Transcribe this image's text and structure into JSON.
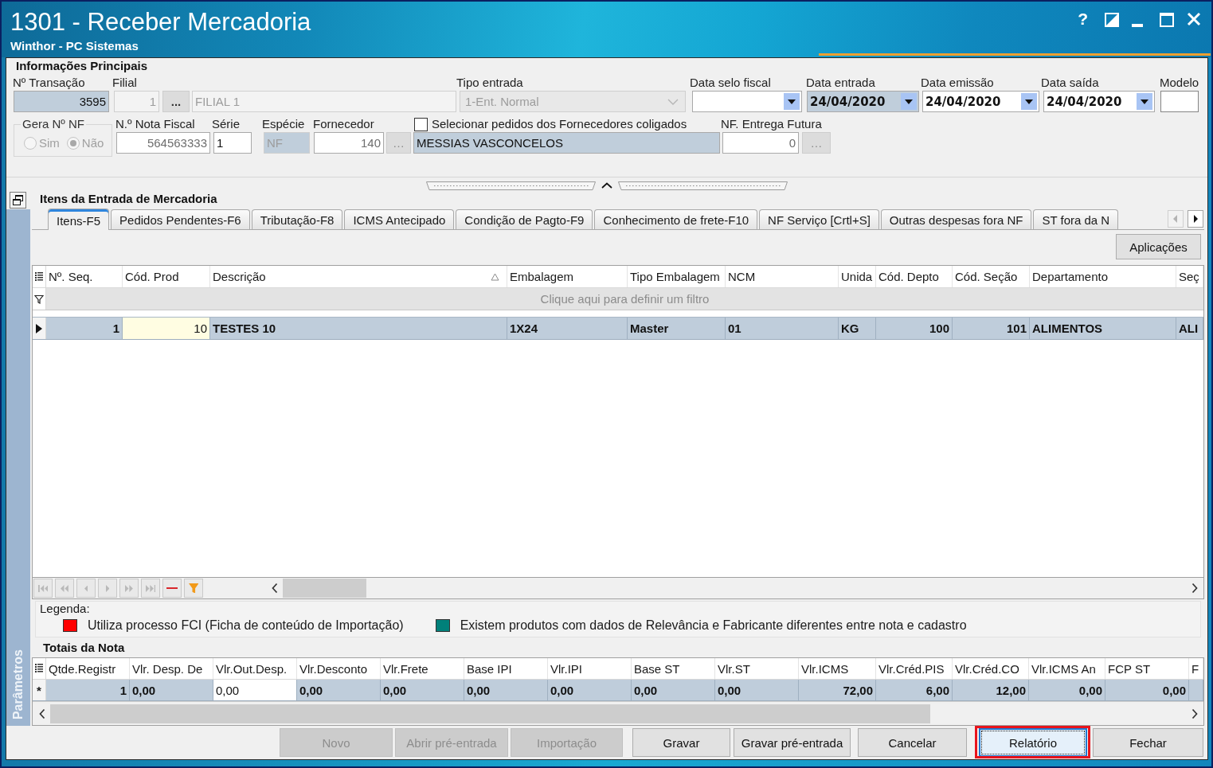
{
  "window": {
    "title": "1301 - Receber Mercadoria",
    "subtitle": "Winthor - PC Sistemas",
    "help_button": "?"
  },
  "main_info": {
    "title": "Informações Principais",
    "transacao": {
      "label": "Nº Transação",
      "value": "3595",
      "readonly": true
    },
    "filial": {
      "label": "Filial",
      "code": "1",
      "button": "...",
      "name": "FILIAL 1",
      "disabled": true
    },
    "tipo_entrada": {
      "label": "Tipo entrada",
      "value": "1-Ent. Normal",
      "disabled": true
    },
    "dates": [
      {
        "label": "Data selo fiscal",
        "readonly": false
      },
      {
        "label": "Data entrada",
        "value": "24/04/2020",
        "readonly": true
      },
      {
        "label": "Data emissão",
        "value": "24/04/2020",
        "readonly": false
      },
      {
        "label": "Data saída",
        "value": "24/04/2020",
        "readonly": false
      }
    ],
    "modelo": {
      "label": "Modelo"
    },
    "gera_nf": {
      "label": "Gera Nº NF",
      "disabled": true,
      "options": [
        {
          "label": "Sim",
          "selected": false
        },
        {
          "label": "Não",
          "selected": true
        }
      ]
    },
    "nota_fiscal": {
      "label": "N.º Nota Fiscal",
      "value": "564563333"
    },
    "serie": {
      "label": "Série",
      "value": "1"
    },
    "especie": {
      "label": "Espécie",
      "value": "NF",
      "readonly": true,
      "disabled": true
    },
    "fornecedor": {
      "label": "Fornecedor",
      "code": "140",
      "button": "…",
      "name": "MESSIAS VASCONCELOS",
      "readonly": true
    },
    "coligados": {
      "label": "Selecionar pedidos dos Fornecedores coligados",
      "checked": false
    },
    "entrega_futura": {
      "label": "NF. Entrega Futura",
      "value": "0",
      "button": "…"
    }
  },
  "sidebar": {
    "label": "Parâmetros"
  },
  "items": {
    "title": "Itens da Entrada de Mercadoria",
    "tabs": [
      {
        "label": "Itens-F5",
        "selected": true
      },
      {
        "label": "Pedidos Pendentes-F6",
        "selected": false
      },
      {
        "label": "Tributação-F8",
        "selected": false
      },
      {
        "label": "ICMS Antecipado",
        "selected": false
      },
      {
        "label": "Condição de Pagto-F9",
        "selected": false
      },
      {
        "label": "Conhecimento de frete-F10",
        "selected": false
      },
      {
        "label": "NF Serviço [Crtl+S]",
        "selected": false
      },
      {
        "label": "Outras despesas fora NF",
        "selected": false
      },
      {
        "label": "ST fora da N",
        "selected": false
      }
    ],
    "apps_button": "Aplicações",
    "grid": {
      "columns": [
        {
          "label": "Nº. Seq.",
          "right_aligned": true,
          "sorted": false
        },
        {
          "label": "Cód. Prod",
          "right_aligned": true,
          "sorted": false
        },
        {
          "label": "Descrição",
          "right_aligned": false,
          "sorted": true
        },
        {
          "label": "Embalagem",
          "right_aligned": false,
          "sorted": false
        },
        {
          "label": "Tipo Embalagem",
          "right_aligned": false,
          "sorted": false
        },
        {
          "label": "NCM",
          "right_aligned": false,
          "sorted": false
        },
        {
          "label": "Unida",
          "right_aligned": false,
          "sorted": false
        },
        {
          "label": "Cód. Depto",
          "right_aligned": true,
          "sorted": false
        },
        {
          "label": "Cód. Seção",
          "right_aligned": true,
          "sorted": false
        },
        {
          "label": "Departamento",
          "right_aligned": false,
          "sorted": false
        },
        {
          "label": "Seç",
          "right_aligned": false,
          "sorted": false
        }
      ],
      "filter_hint": "Clique aqui para definir um filtro",
      "rows": [
        {
          "selected": true,
          "cells": [
            {
              "value": "1",
              "focused": false
            },
            {
              "value": "10",
              "focused": true
            },
            {
              "value": "TESTES 10",
              "focused": false
            },
            {
              "value": "1X24",
              "focused": false
            },
            {
              "value": "Master",
              "focused": false
            },
            {
              "value": "01",
              "focused": false
            },
            {
              "value": "KG",
              "focused": false
            },
            {
              "value": "100",
              "focused": false
            },
            {
              "value": "101",
              "focused": false
            },
            {
              "value": "ALIMENTOS",
              "focused": false
            },
            {
              "value": "ALI",
              "focused": false
            }
          ]
        }
      ]
    },
    "navigator": [
      {
        "kind": "first",
        "disabled": true
      },
      {
        "kind": "prev_page",
        "disabled": true
      },
      {
        "kind": "prev",
        "disabled": true
      },
      {
        "kind": "next",
        "disabled": true
      },
      {
        "kind": "next_page",
        "disabled": true
      },
      {
        "kind": "last",
        "disabled": true
      },
      {
        "kind": "delete",
        "disabled": false
      },
      {
        "kind": "filter",
        "disabled": false
      }
    ]
  },
  "legend": {
    "title": "Legenda:",
    "items": [
      {
        "label": "Utiliza processo FCI (Ficha de conteúdo de Importação)",
        "color": "#ff0000"
      },
      {
        "label": "Existem produtos com dados de Relevância e Fabricante diferentes entre nota e cadastro",
        "color": "#00807a"
      }
    ]
  },
  "totals": {
    "title": "Totais da Nota",
    "columns": [
      {
        "label": "Qtde.Registr"
      },
      {
        "label": "Vlr. Desp. De"
      },
      {
        "label": "Vlr.Out.Desp."
      },
      {
        "label": "Vlr.Desconto"
      },
      {
        "label": "Vlr.Frete"
      },
      {
        "label": "Base IPI"
      },
      {
        "label": "Vlr.IPI"
      },
      {
        "label": "Base ST"
      },
      {
        "label": "Vlr.ST"
      },
      {
        "label": "Vlr.ICMS"
      },
      {
        "label": "Vlr.Créd.PIS"
      },
      {
        "label": "Vlr.Créd.CO"
      },
      {
        "label": "Vlr.ICMS An"
      },
      {
        "label": "FCP ST"
      },
      {
        "label": "F"
      }
    ],
    "row": {
      "indicator": "*",
      "selected": true,
      "cells": [
        {
          "value": "1",
          "focused": false,
          "right_aligned": true
        },
        {
          "value": "0,00",
          "focused": false,
          "right_aligned": false
        },
        {
          "value": "0,00",
          "focused": true,
          "right_aligned": false
        },
        {
          "value": "0,00",
          "focused": false,
          "right_aligned": false
        },
        {
          "value": "0,00",
          "focused": false,
          "right_aligned": false
        },
        {
          "value": "0,00",
          "focused": false,
          "right_aligned": false
        },
        {
          "value": "0,00",
          "focused": false,
          "right_aligned": false
        },
        {
          "value": "0,00",
          "focused": false,
          "right_aligned": false
        },
        {
          "value": "0,00",
          "focused": false,
          "right_aligned": false
        },
        {
          "value": "72,00",
          "focused": false,
          "right_aligned": true
        },
        {
          "value": "6,00",
          "focused": false,
          "right_aligned": true
        },
        {
          "value": "12,00",
          "focused": false,
          "right_aligned": true
        },
        {
          "value": "0,00",
          "focused": false,
          "right_aligned": true
        },
        {
          "value": "0,00",
          "focused": false,
          "right_aligned": true
        }
      ]
    }
  },
  "buttons": [
    {
      "label": "Novo",
      "disabled": true,
      "focused": false,
      "highlighted": false
    },
    {
      "label": "Abrir pré-entrada",
      "disabled": true,
      "focused": false,
      "highlighted": false
    },
    {
      "label": "Importação",
      "disabled": true,
      "focused": false,
      "highlighted": false
    },
    {
      "label": "Gravar",
      "disabled": false,
      "focused": false,
      "highlighted": false
    },
    {
      "label": "Gravar pré-entrada",
      "disabled": false,
      "focused": false,
      "highlighted": false
    },
    {
      "label": "Cancelar",
      "disabled": false,
      "focused": false,
      "highlighted": false
    },
    {
      "label": "Relatório",
      "disabled": false,
      "focused": true,
      "highlighted": true
    },
    {
      "label": "Fechar",
      "disabled": false,
      "focused": false,
      "highlighted": false
    }
  ]
}
